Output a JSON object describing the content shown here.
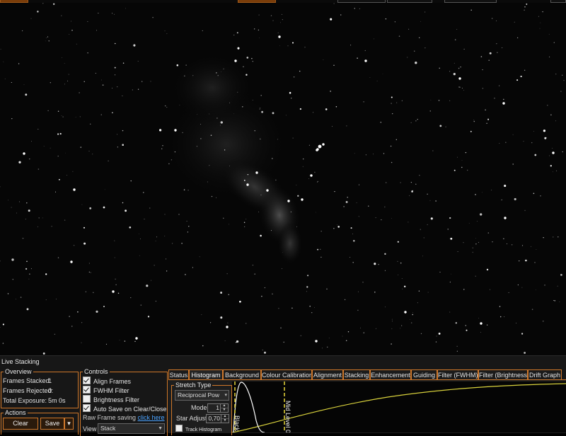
{
  "panel": {
    "title": "Live Stacking"
  },
  "overview": {
    "label": "Overview",
    "stats": [
      {
        "label": "Frames Stacked:",
        "value": "1"
      },
      {
        "label": "Frames Rejected:",
        "value": "0"
      },
      {
        "label": "Total Exposure:",
        "value": "5m 0s"
      }
    ]
  },
  "actions": {
    "label": "Actions",
    "clear": "Clear",
    "save": "Save",
    "dropdown": "▾"
  },
  "controls": {
    "label": "Controls",
    "checkboxes": [
      {
        "label": "Align Frames",
        "checked": true
      },
      {
        "label": "FWHM Filter",
        "checked": true
      },
      {
        "label": "Brightness Filter",
        "checked": false
      },
      {
        "label": "Auto Save on Clear/Close",
        "checked": true
      }
    ],
    "raw_frame_text": "Raw Frame saving",
    "raw_frame_link": "click here",
    "view_label": "View",
    "view_value": "Stack"
  },
  "tabs": [
    "Status",
    "Histogram",
    "Background",
    "Colour Calibration",
    "Alignment",
    "Stacking",
    "Enhancement",
    "Guiding",
    "Filter (FWHM)",
    "Filter (Brightness)",
    "Drift Graph"
  ],
  "active_tab": "Histogram",
  "histogram": {
    "stretch_type_label": "Stretch Type",
    "stretch_value": "Reciprocal Pow",
    "mode_label": "Mode",
    "mode_value": "1",
    "star_adjust_label": "Star Adjust",
    "star_adjust_value": "0,70",
    "track_label": "Track Histogram",
    "black_label": "Black L",
    "mid_label": "Mid Level",
    "mid_suffix": "0"
  },
  "colors": {
    "accent": "#d0782a",
    "curve": "#d9d23c",
    "marker": "#e8d83a"
  }
}
